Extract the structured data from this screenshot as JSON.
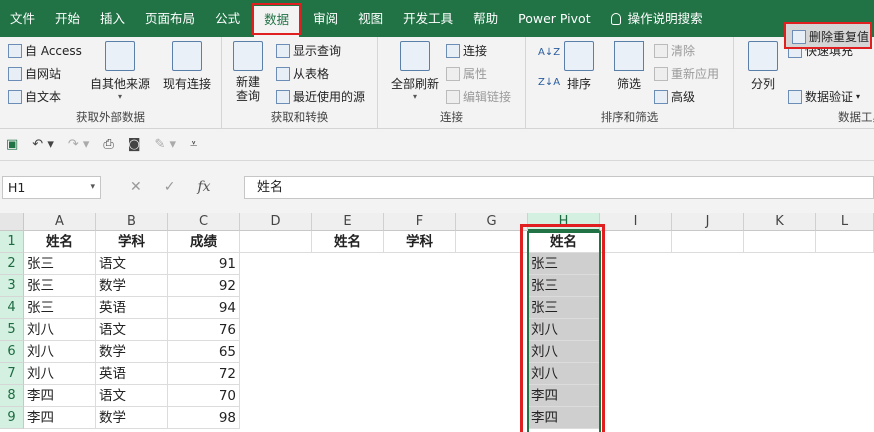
{
  "tabs": [
    "文件",
    "开始",
    "插入",
    "页面布局",
    "公式",
    "数据",
    "审阅",
    "视图",
    "开发工具",
    "帮助",
    "Power Pivot",
    "操作说明搜索"
  ],
  "active_tab_index": 5,
  "ribbon": {
    "get_external": {
      "items": [
        "自 Access",
        "自网站",
        "自文本"
      ],
      "other_sources": "自其他来源",
      "existing_conn": "现有连接",
      "label": "获取外部数据"
    },
    "get_transform": {
      "new_query": "新建\n查询",
      "items": [
        "显示查询",
        "从表格",
        "最近使用的源"
      ],
      "label": "获取和转换"
    },
    "connections": {
      "refresh_all": "全部刷新",
      "items": [
        "连接",
        "属性",
        "编辑链接"
      ],
      "label": "连接"
    },
    "sort_filter": {
      "sort": "排序",
      "filter": "筛选",
      "items": [
        "清除",
        "重新应用",
        "高级"
      ],
      "label": "排序和筛选"
    },
    "data_tools": {
      "split": "分列",
      "flash_fill": "快速填充",
      "remove_dup": "删除重复值",
      "validation": "数据验证",
      "label": "数据工具"
    }
  },
  "formula_bar": {
    "name_box": "H1",
    "formula": "姓名"
  },
  "columns": [
    "A",
    "B",
    "C",
    "D",
    "E",
    "F",
    "G",
    "H",
    "I",
    "J",
    "K",
    "L"
  ],
  "rows": [
    "1",
    "2",
    "3",
    "4",
    "5",
    "6",
    "7",
    "8",
    "9"
  ],
  "cells": {
    "A": [
      "姓名",
      "张三",
      "张三",
      "张三",
      "刘八",
      "刘八",
      "刘八",
      "李四",
      "李四"
    ],
    "B": [
      "学科",
      "语文",
      "数学",
      "英语",
      "语文",
      "数学",
      "英语",
      "语文",
      "数学"
    ],
    "C": [
      "成绩",
      "91",
      "92",
      "94",
      "76",
      "65",
      "72",
      "70",
      "98"
    ],
    "E1": "姓名",
    "F1": "学科",
    "H": [
      "姓名",
      "张三",
      "张三",
      "张三",
      "刘八",
      "刘八",
      "刘八",
      "李四",
      "李四"
    ]
  }
}
